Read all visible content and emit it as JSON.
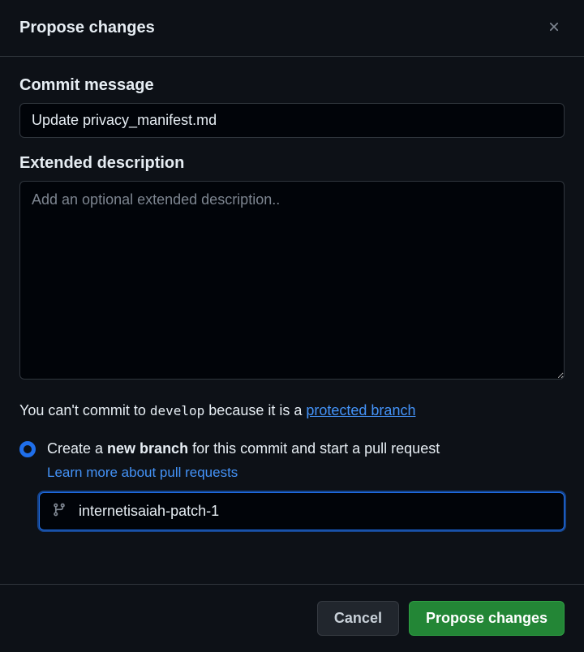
{
  "dialog": {
    "title": "Propose changes"
  },
  "commit": {
    "label": "Commit message",
    "value": "Update privacy_manifest.md"
  },
  "description": {
    "label": "Extended description",
    "placeholder": "Add an optional extended description.."
  },
  "protected_notice": {
    "prefix": "You can't commit to ",
    "branch": "develop",
    "middle": " because it is a ",
    "link_text": "protected branch"
  },
  "radio": {
    "text_prefix": "Create a ",
    "text_bold": "new branch",
    "text_suffix": " for this commit and start a pull request",
    "learn_more": "Learn more about pull requests"
  },
  "branch_input": {
    "value": "internetisaiah-patch-1"
  },
  "footer": {
    "cancel": "Cancel",
    "submit": "Propose changes"
  }
}
